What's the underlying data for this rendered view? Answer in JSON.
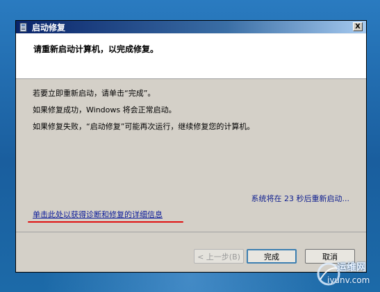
{
  "window": {
    "title": "启动修复",
    "close_glyph": "X",
    "heading": "请重新启动计算机，以完成修复。"
  },
  "body": {
    "lines": [
      "若要立即重新启动，请单击“完成”。",
      "如果修复成功，Windows 将会正常启动。",
      "如果修复失败，“启动修复”可能再次运行，继续修复您的计算机。"
    ],
    "countdown": "系统将在 23 秒后重新启动...",
    "details_link": "单击此处以获得诊断和修复的详细信息"
  },
  "buttons": {
    "back": "< 上一步(B)",
    "finish": "完成",
    "cancel": "取消"
  },
  "watermark": {
    "text1": "运维网",
    "text2": "iyunv.com"
  },
  "colors": {
    "link": "#0a1a9a",
    "underline_mark": "#e01010",
    "titlebar_start": "#0a246a"
  }
}
